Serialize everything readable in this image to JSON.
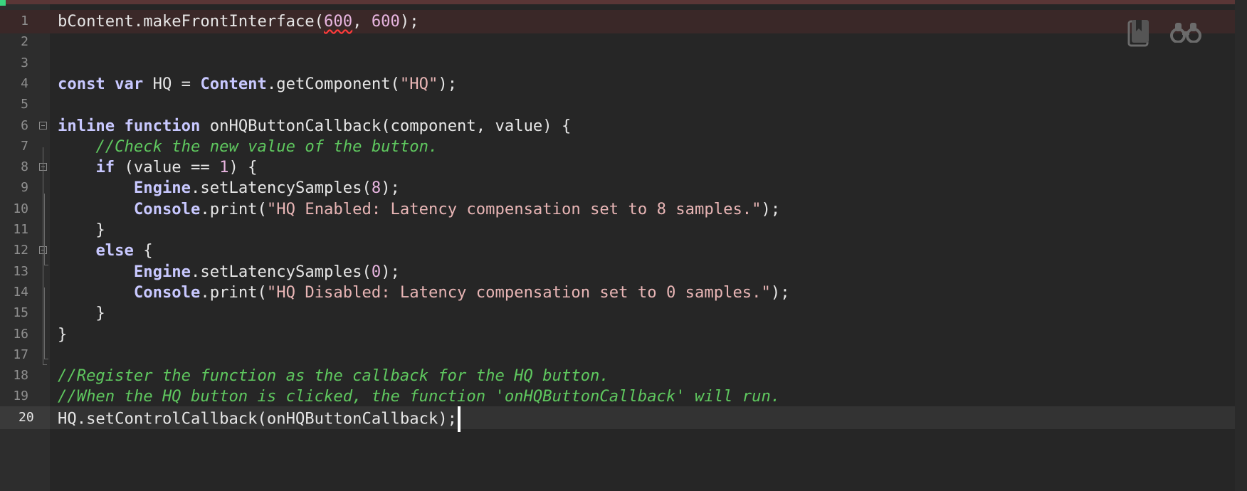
{
  "editor": {
    "toolbar": {
      "bookmark_icon": "bookmark-icon",
      "search_icon": "binoculars-icon"
    },
    "colors": {
      "background": "#262626",
      "gutter": "#2d2d2d",
      "keyword": "#c8c8ff",
      "string": "#e8b5b5",
      "number": "#e8b5e0",
      "comment": "#5fc85f",
      "error_underline": "#ff3b3b",
      "error_line_bg": "#3a2828"
    },
    "lines": [
      {
        "num": "1",
        "tokens": [
          [
            "plain",
            "bContent.makeFrontInterface("
          ],
          [
            "numerr",
            "600"
          ],
          [
            "plain",
            ", "
          ],
          [
            "num",
            "600"
          ],
          [
            "plain",
            ");"
          ]
        ]
      },
      {
        "num": "2",
        "tokens": []
      },
      {
        "num": "3",
        "tokens": []
      },
      {
        "num": "4",
        "tokens": [
          [
            "kw",
            "const"
          ],
          [
            "plain",
            " "
          ],
          [
            "kw",
            "var"
          ],
          [
            "plain",
            " HQ = "
          ],
          [
            "obj",
            "Content"
          ],
          [
            "plain",
            ".getComponent("
          ],
          [
            "str",
            "\"HQ\""
          ],
          [
            "plain",
            ");"
          ]
        ]
      },
      {
        "num": "5",
        "tokens": []
      },
      {
        "num": "6",
        "tokens": [
          [
            "kw",
            "inline"
          ],
          [
            "plain",
            " "
          ],
          [
            "kw",
            "function"
          ],
          [
            "plain",
            " onHQButtonCallback(component, value) {"
          ]
        ]
      },
      {
        "num": "7",
        "tokens": [
          [
            "plain",
            "    "
          ],
          [
            "cmt",
            "//Check the new value of the button."
          ]
        ]
      },
      {
        "num": "8",
        "tokens": [
          [
            "plain",
            "    "
          ],
          [
            "kw",
            "if"
          ],
          [
            "plain",
            " (value == "
          ],
          [
            "num",
            "1"
          ],
          [
            "plain",
            ") {"
          ]
        ]
      },
      {
        "num": "9",
        "tokens": [
          [
            "plain",
            "        "
          ],
          [
            "obj",
            "Engine"
          ],
          [
            "plain",
            ".setLatencySamples("
          ],
          [
            "num",
            "8"
          ],
          [
            "plain",
            ");"
          ]
        ]
      },
      {
        "num": "10",
        "tokens": [
          [
            "plain",
            "        "
          ],
          [
            "obj",
            "Console"
          ],
          [
            "plain",
            ".print("
          ],
          [
            "str",
            "\"HQ Enabled: Latency compensation set to 8 samples.\""
          ],
          [
            "plain",
            ");"
          ]
        ]
      },
      {
        "num": "11",
        "tokens": [
          [
            "plain",
            "    }"
          ]
        ]
      },
      {
        "num": "12",
        "tokens": [
          [
            "plain",
            "    "
          ],
          [
            "kw",
            "else"
          ],
          [
            "plain",
            " {"
          ]
        ]
      },
      {
        "num": "13",
        "tokens": [
          [
            "plain",
            "        "
          ],
          [
            "obj",
            "Engine"
          ],
          [
            "plain",
            ".setLatencySamples("
          ],
          [
            "num",
            "0"
          ],
          [
            "plain",
            ");"
          ]
        ]
      },
      {
        "num": "14",
        "tokens": [
          [
            "plain",
            "        "
          ],
          [
            "obj",
            "Console"
          ],
          [
            "plain",
            ".print("
          ],
          [
            "str",
            "\"HQ Disabled: Latency compensation set to 0 samples.\""
          ],
          [
            "plain",
            ");"
          ]
        ]
      },
      {
        "num": "15",
        "tokens": [
          [
            "plain",
            "    }"
          ]
        ]
      },
      {
        "num": "16",
        "tokens": [
          [
            "plain",
            "}"
          ]
        ]
      },
      {
        "num": "17",
        "tokens": []
      },
      {
        "num": "18",
        "tokens": [
          [
            "cmt",
            "//Register the function as the callback for the HQ button."
          ]
        ]
      },
      {
        "num": "19",
        "tokens": [
          [
            "cmt",
            "//When the HQ button is clicked, the function 'onHQButtonCallback' will run."
          ]
        ]
      },
      {
        "num": "20",
        "tokens": [
          [
            "plain",
            "HQ.setControlCallback(onHQButtonCallback);"
          ],
          [
            "caret",
            ""
          ]
        ]
      }
    ],
    "error_line": "1",
    "current_line": "20",
    "fold_lines": [
      "6",
      "8",
      "12"
    ]
  }
}
